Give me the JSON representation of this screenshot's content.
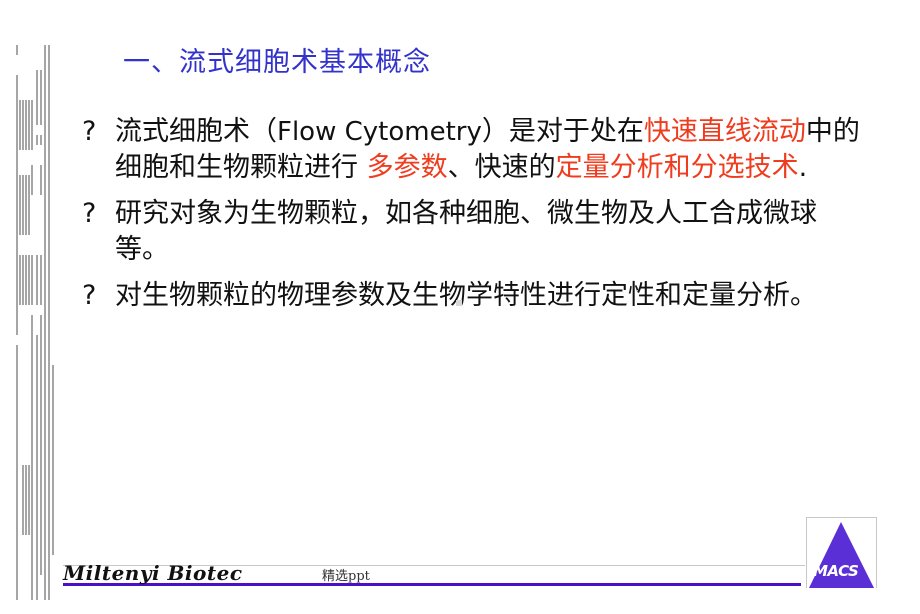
{
  "slide": {
    "title": "一、流式细胞术基本概念",
    "bullet_mark": "?",
    "bullets": [
      {
        "segments": [
          {
            "text": "流式细胞术（",
            "style": "normal"
          },
          {
            "text": "Flow Cytometry",
            "style": "latin"
          },
          {
            "text": "）是对于处在",
            "style": "normal"
          },
          {
            "text": "快速直线流动",
            "style": "highlight"
          },
          {
            "text": "中的细胞和生物颗粒进行 ",
            "style": "normal"
          },
          {
            "text": "多参数",
            "style": "highlight"
          },
          {
            "text": "、快速的",
            "style": "normal"
          },
          {
            "text": "定量分析和分选技术",
            "style": "highlight"
          },
          {
            "text": ".",
            "style": "normal"
          }
        ]
      },
      {
        "segments": [
          {
            "text": "研究对象为生物颗粒，如各种细胞、微生物及人工合成微球等。",
            "style": "normal"
          }
        ]
      },
      {
        "segments": [
          {
            "text": "对生物颗粒的物理参数及生物学特性进行定性和定量分析。",
            "style": "normal"
          }
        ]
      }
    ]
  },
  "footer": {
    "brand": "Miltenyi Biotec",
    "note": "精选ppt",
    "logo_text": "MACS"
  },
  "colors": {
    "title": "#3333cc",
    "highlight": "#f03c1e",
    "body": "#111111",
    "footer_rule": "#4a10c8",
    "logo": "#5a2fd6"
  }
}
